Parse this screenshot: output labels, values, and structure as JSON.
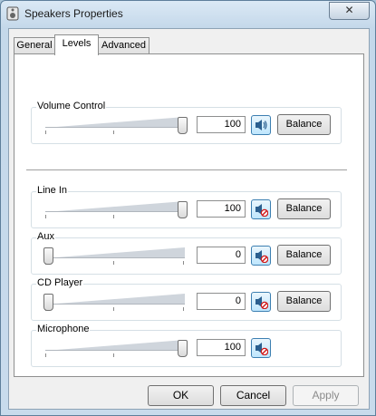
{
  "window": {
    "title": "Speakers Properties",
    "close_glyph": "✕"
  },
  "tabs": [
    {
      "label": "General"
    },
    {
      "label": "Levels"
    },
    {
      "label": "Advanced"
    }
  ],
  "levels": {
    "volume": {
      "label": "Volume Control",
      "value": "100",
      "level": 1.0,
      "muted": false,
      "balance_label": "Balance"
    },
    "line_in": {
      "label": "Line In",
      "value": "100",
      "level": 1.0,
      "muted": true,
      "balance_label": "Balance"
    },
    "aux": {
      "label": "Aux",
      "value": "0",
      "level": 0.0,
      "muted": true,
      "balance_label": "Balance"
    },
    "cd_player": {
      "label": "CD Player",
      "value": "0",
      "level": 0.0,
      "muted": true,
      "balance_label": "Balance"
    },
    "microphone": {
      "label": "Microphone",
      "value": "100",
      "level": 1.0,
      "muted": true
    }
  },
  "buttons": {
    "ok": "OK",
    "cancel": "Cancel",
    "apply": "Apply"
  },
  "icons": {
    "speaker": "speaker-icon",
    "speaker_muted": "speaker-muted-icon"
  }
}
